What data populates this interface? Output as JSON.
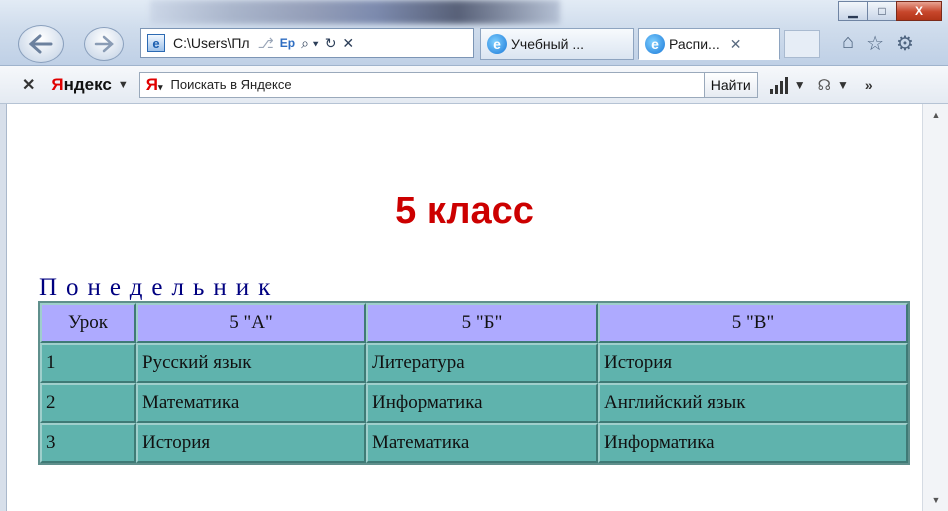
{
  "window": {
    "minimize_glyph": "▁",
    "maximize_glyph": "□",
    "close_glyph": "X"
  },
  "address_bar": {
    "url": "C:\\Users\\Пл",
    "page_icon": "e",
    "tools": [
      "⎇",
      "Ep",
      "⌕ ▾",
      "↻",
      "✕"
    ]
  },
  "tabs": [
    {
      "label": "Учебный ...",
      "icon": "ie-icon",
      "active": false
    },
    {
      "label": "Распи...",
      "icon": "ie-icon",
      "active": true,
      "close": "✕"
    }
  ],
  "toolbar_icons": [
    "⌂",
    "☆",
    "⚙"
  ],
  "yandex": {
    "close": "✕",
    "brand_first": "Я",
    "brand_rest": "ндекс",
    "dropdown": "▼",
    "search_logo": "Я",
    "search_placeholder": "Поискать в Яндексе",
    "find_label": "Найти",
    "more": "»"
  },
  "page": {
    "title": "5 класс",
    "day": "Понедельник",
    "table": {
      "headers": [
        "Урок",
        "5 \"А\"",
        "5 \"Б\"",
        "5 \"В\""
      ],
      "rows": [
        [
          "1",
          "Русский язык",
          "Литература",
          "История"
        ],
        [
          "2",
          "Математика",
          "Информатика",
          "Английский язык"
        ],
        [
          "3",
          "История",
          "Математика",
          "Информатика"
        ]
      ]
    }
  },
  "colors": {
    "title": "#cc0000",
    "day": "#000080",
    "header_bg": "#aeaaff",
    "cell_bg": "#5fb3ad"
  }
}
